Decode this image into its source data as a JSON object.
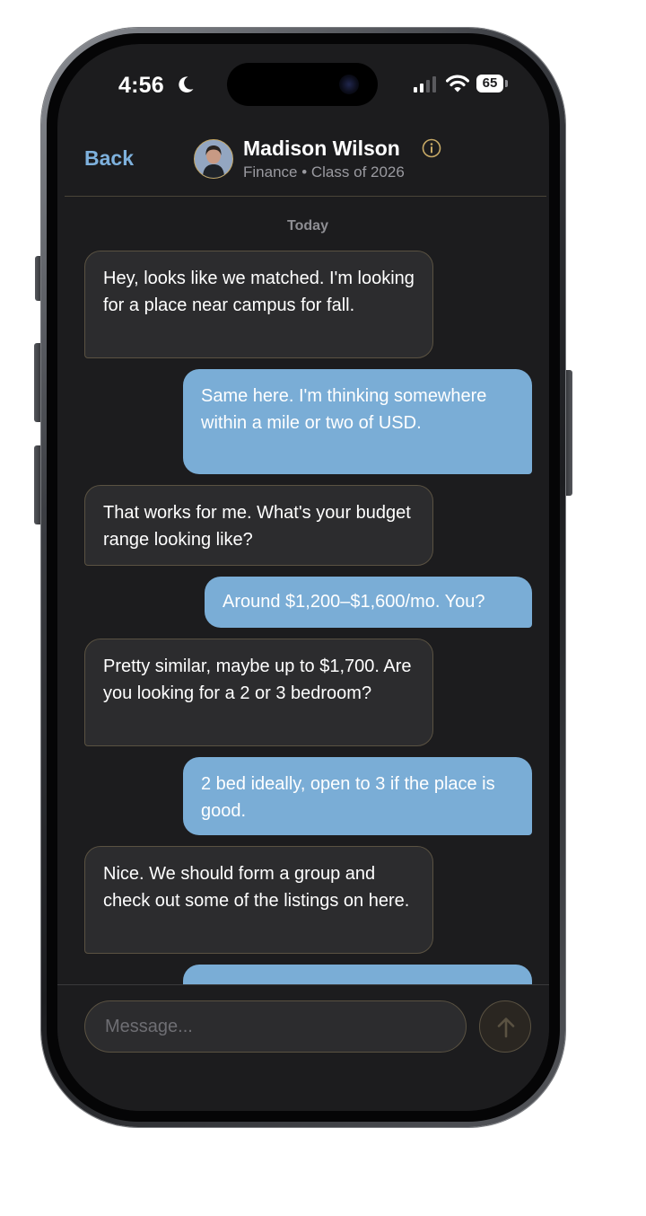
{
  "status_bar": {
    "time": "4:56",
    "battery_level": "65",
    "icons": [
      "moon-icon",
      "signal-icon",
      "wifi-icon",
      "battery-icon"
    ]
  },
  "header": {
    "back_label": "Back",
    "contact_name": "Madison Wilson",
    "contact_subtitle": "Finance • Class of 2026",
    "icons": [
      "avatar",
      "info-icon"
    ]
  },
  "conversation": {
    "date_label": "Today",
    "messages": [
      {
        "direction": "incoming",
        "text": "Hey, looks like we matched. I'm looking for a place near campus for fall."
      },
      {
        "direction": "outgoing",
        "text": "Same here. I'm thinking somewhere within a mile or two of USD."
      },
      {
        "direction": "incoming",
        "text": "That works for me. What's your budget range looking like?"
      },
      {
        "direction": "outgoing",
        "text": "Around $1,200–$1,600/mo. You?"
      },
      {
        "direction": "incoming",
        "text": "Pretty similar, maybe up to $1,700. Are you looking for a 2 or 3 bedroom?"
      },
      {
        "direction": "outgoing",
        "text": "2 bed ideally, open to 3 if the place is good."
      },
      {
        "direction": "incoming",
        "text": "Nice. We should form a group and check out some of the listings on here."
      },
      {
        "direction": "outgoing",
        "text": ""
      }
    ]
  },
  "composer": {
    "placeholder": "Message...",
    "value": "",
    "send_icon": "arrow-up-icon"
  },
  "colors": {
    "accent": "#7eb1dd",
    "outgoing_bubble": "#7aadd6",
    "incoming_bubble": "#2c2c2e",
    "bubble_border": "#5a5242",
    "background": "#1c1c1e"
  }
}
